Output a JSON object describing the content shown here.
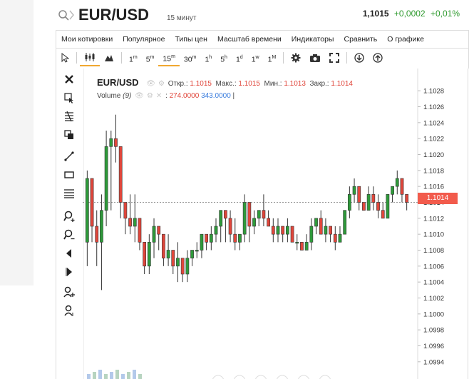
{
  "header": {
    "symbol": "EUR/USD",
    "interval": "15 минут",
    "price": "1,1015",
    "change": "+0,0002",
    "change_pct": "+0,01%"
  },
  "menu": [
    "Мои котировки",
    "Популярное",
    "Типы цен",
    "Масштаб времени",
    "Индикаторы",
    "Сравнить",
    "О графике"
  ],
  "timeframes": [
    {
      "n": "1",
      "u": "m"
    },
    {
      "n": "5",
      "u": "m"
    },
    {
      "n": "15",
      "u": "m",
      "active": true
    },
    {
      "n": "30",
      "u": "m"
    },
    {
      "n": "1",
      "u": "h"
    },
    {
      "n": "5",
      "u": "h"
    },
    {
      "n": "1",
      "u": "d"
    },
    {
      "n": "1",
      "u": "w"
    },
    {
      "n": "1",
      "u": "M"
    }
  ],
  "toolbar_icons": [
    "cursor-icon",
    "candles-icon",
    "area-icon",
    "gear-icon",
    "camera-icon",
    "fullscreen-icon",
    "download-icon",
    "upload-icon"
  ],
  "drawing_tools": [
    "close-icon",
    "cursor-cross-icon",
    "fibonacci-icon",
    "copy-icon",
    "trendline-icon",
    "rectangle-icon",
    "lines-icon",
    "zoom-in-icon",
    "zoom-out-icon",
    "arrow-left-icon",
    "arrow-right-icon",
    "person-plus-icon",
    "person-icon"
  ],
  "legend": {
    "symbol": "EUR/USD",
    "open_label": "Откр.:",
    "open": "1.1015",
    "high_label": "Макс.:",
    "high": "1.1015",
    "low_label": "Мин.:",
    "low": "1.1013",
    "close_label": "Закр.:",
    "close": "1.1014",
    "volume_label": "Volume",
    "volume_period": "(9)",
    "volume_a": "274.0000",
    "volume_b": "343.0000"
  },
  "last_price": "1.1014",
  "colors": {
    "up": "#2e9a3a",
    "down": "#e0463b",
    "accent": "#f0a830",
    "price_tag": "#f25b4c"
  },
  "chart_data": {
    "type": "candlestick",
    "yticks": [
      "1.1028",
      "1.1026",
      "1.1024",
      "1.1022",
      "1.1020",
      "1.1018",
      "1.1016",
      "1.1014",
      "1.1012",
      "1.1010",
      "1.1008",
      "1.1006",
      "1.1004",
      "1.1002",
      "1.1000",
      "1.0998",
      "1.0996",
      "1.0994"
    ],
    "ylim": [
      1.0993,
      1.1029
    ],
    "last": 1.1014,
    "candles": [
      {
        "o": 1.1009,
        "h": 1.1018,
        "l": 1.1006,
        "c": 1.1017
      },
      {
        "o": 1.1017,
        "h": 1.1017,
        "l": 1.1009,
        "c": 1.1011
      },
      {
        "o": 1.1011,
        "h": 1.1013,
        "l": 1.1006,
        "c": 1.1009
      },
      {
        "o": 1.1009,
        "h": 1.1015,
        "l": 1.1003,
        "c": 1.1013
      },
      {
        "o": 1.1013,
        "h": 1.1023,
        "l": 1.1011,
        "c": 1.1021
      },
      {
        "o": 1.1021,
        "h": 1.1023,
        "l": 1.1013,
        "c": 1.1022
      },
      {
        "o": 1.1022,
        "h": 1.1025,
        "l": 1.1019,
        "c": 1.1021
      },
      {
        "o": 1.1021,
        "h": 1.1021,
        "l": 1.1012,
        "c": 1.1014
      },
      {
        "o": 1.1014,
        "h": 1.1014,
        "l": 1.101,
        "c": 1.1012
      },
      {
        "o": 1.1012,
        "h": 1.1015,
        "l": 1.101,
        "c": 1.1011
      },
      {
        "o": 1.1011,
        "h": 1.1015,
        "l": 1.1009,
        "c": 1.1012
      },
      {
        "o": 1.1012,
        "h": 1.1012,
        "l": 1.1008,
        "c": 1.1009
      },
      {
        "o": 1.1009,
        "h": 1.1009,
        "l": 1.1005,
        "c": 1.1006
      },
      {
        "o": 1.1006,
        "h": 1.101,
        "l": 1.1005,
        "c": 1.1009
      },
      {
        "o": 1.1009,
        "h": 1.1012,
        "l": 1.1007,
        "c": 1.1011
      },
      {
        "o": 1.1011,
        "h": 1.1011,
        "l": 1.1008,
        "c": 1.101
      },
      {
        "o": 1.101,
        "h": 1.101,
        "l": 1.1006,
        "c": 1.1007
      },
      {
        "o": 1.1007,
        "h": 1.101,
        "l": 1.1006,
        "c": 1.1008
      },
      {
        "o": 1.1008,
        "h": 1.1008,
        "l": 1.1005,
        "c": 1.1006
      },
      {
        "o": 1.1006,
        "h": 1.1009,
        "l": 1.1004,
        "c": 1.1007
      },
      {
        "o": 1.1007,
        "h": 1.1007,
        "l": 1.1004,
        "c": 1.1005
      },
      {
        "o": 1.1005,
        "h": 1.1008,
        "l": 1.1004,
        "c": 1.1007
      },
      {
        "o": 1.1007,
        "h": 1.1008,
        "l": 1.1006,
        "c": 1.1008
      },
      {
        "o": 1.1008,
        "h": 1.1009,
        "l": 1.1007,
        "c": 1.1008
      },
      {
        "o": 1.1008,
        "h": 1.101,
        "l": 1.1007,
        "c": 1.101
      },
      {
        "o": 1.101,
        "h": 1.101,
        "l": 1.1008,
        "c": 1.1009
      },
      {
        "o": 1.1009,
        "h": 1.1011,
        "l": 1.1008,
        "c": 1.101
      },
      {
        "o": 1.101,
        "h": 1.1012,
        "l": 1.1009,
        "c": 1.1011
      },
      {
        "o": 1.1011,
        "h": 1.1013,
        "l": 1.1009,
        "c": 1.1013
      },
      {
        "o": 1.1013,
        "h": 1.1013,
        "l": 1.1009,
        "c": 1.1012
      },
      {
        "o": 1.1012,
        "h": 1.1013,
        "l": 1.1009,
        "c": 1.101
      },
      {
        "o": 1.101,
        "h": 1.1012,
        "l": 1.1008,
        "c": 1.1009
      },
      {
        "o": 1.1009,
        "h": 1.101,
        "l": 1.1008,
        "c": 1.101
      },
      {
        "o": 1.101,
        "h": 1.1015,
        "l": 1.1009,
        "c": 1.1014
      },
      {
        "o": 1.1014,
        "h": 1.1014,
        "l": 1.1009,
        "c": 1.1011
      },
      {
        "o": 1.1011,
        "h": 1.1013,
        "l": 1.101,
        "c": 1.1012
      },
      {
        "o": 1.1012,
        "h": 1.1013,
        "l": 1.1011,
        "c": 1.1013
      },
      {
        "o": 1.1013,
        "h": 1.1015,
        "l": 1.1011,
        "c": 1.1012
      },
      {
        "o": 1.1012,
        "h": 1.1013,
        "l": 1.1011,
        "c": 1.1011
      },
      {
        "o": 1.1011,
        "h": 1.1012,
        "l": 1.1009,
        "c": 1.101
      },
      {
        "o": 1.101,
        "h": 1.1012,
        "l": 1.1009,
        "c": 1.1011
      },
      {
        "o": 1.1011,
        "h": 1.1011,
        "l": 1.1009,
        "c": 1.101
      },
      {
        "o": 1.101,
        "h": 1.1012,
        "l": 1.1009,
        "c": 1.1011
      },
      {
        "o": 1.1011,
        "h": 1.1011,
        "l": 1.1009,
        "c": 1.1009
      },
      {
        "o": 1.1009,
        "h": 1.101,
        "l": 1.1008,
        "c": 1.1009
      },
      {
        "o": 1.1009,
        "h": 1.1009,
        "l": 1.1008,
        "c": 1.1008
      },
      {
        "o": 1.1008,
        "h": 1.101,
        "l": 1.1008,
        "c": 1.1009
      },
      {
        "o": 1.1009,
        "h": 1.1012,
        "l": 1.1008,
        "c": 1.1011
      },
      {
        "o": 1.1011,
        "h": 1.1012,
        "l": 1.101,
        "c": 1.1012
      },
      {
        "o": 1.1012,
        "h": 1.1013,
        "l": 1.101,
        "c": 1.101
      },
      {
        "o": 1.101,
        "h": 1.1012,
        "l": 1.1009,
        "c": 1.1011
      },
      {
        "o": 1.1011,
        "h": 1.1011,
        "l": 1.1009,
        "c": 1.101
      },
      {
        "o": 1.101,
        "h": 1.1011,
        "l": 1.1008,
        "c": 1.1009
      },
      {
        "o": 1.1009,
        "h": 1.1011,
        "l": 1.1009,
        "c": 1.101
      },
      {
        "o": 1.101,
        "h": 1.1013,
        "l": 1.101,
        "c": 1.1013
      },
      {
        "o": 1.1013,
        "h": 1.1016,
        "l": 1.1012,
        "c": 1.1015
      },
      {
        "o": 1.1015,
        "h": 1.1017,
        "l": 1.1014,
        "c": 1.1016
      },
      {
        "o": 1.1016,
        "h": 1.1016,
        "l": 1.1013,
        "c": 1.1014
      },
      {
        "o": 1.1014,
        "h": 1.1014,
        "l": 1.1013,
        "c": 1.1013
      },
      {
        "o": 1.1013,
        "h": 1.1016,
        "l": 1.1013,
        "c": 1.1015
      },
      {
        "o": 1.1015,
        "h": 1.1016,
        "l": 1.1013,
        "c": 1.1014
      },
      {
        "o": 1.1014,
        "h": 1.1015,
        "l": 1.1012,
        "c": 1.1013
      },
      {
        "o": 1.1013,
        "h": 1.1014,
        "l": 1.1012,
        "c": 1.1012
      },
      {
        "o": 1.1012,
        "h": 1.1015,
        "l": 1.1012,
        "c": 1.1015
      },
      {
        "o": 1.1015,
        "h": 1.1016,
        "l": 1.1014,
        "c": 1.1016
      },
      {
        "o": 1.1016,
        "h": 1.1018,
        "l": 1.1015,
        "c": 1.1017
      },
      {
        "o": 1.1017,
        "h": 1.1017,
        "l": 1.1014,
        "c": 1.1015
      },
      {
        "o": 1.1015,
        "h": 1.1015,
        "l": 1.1013,
        "c": 1.1014
      }
    ]
  }
}
